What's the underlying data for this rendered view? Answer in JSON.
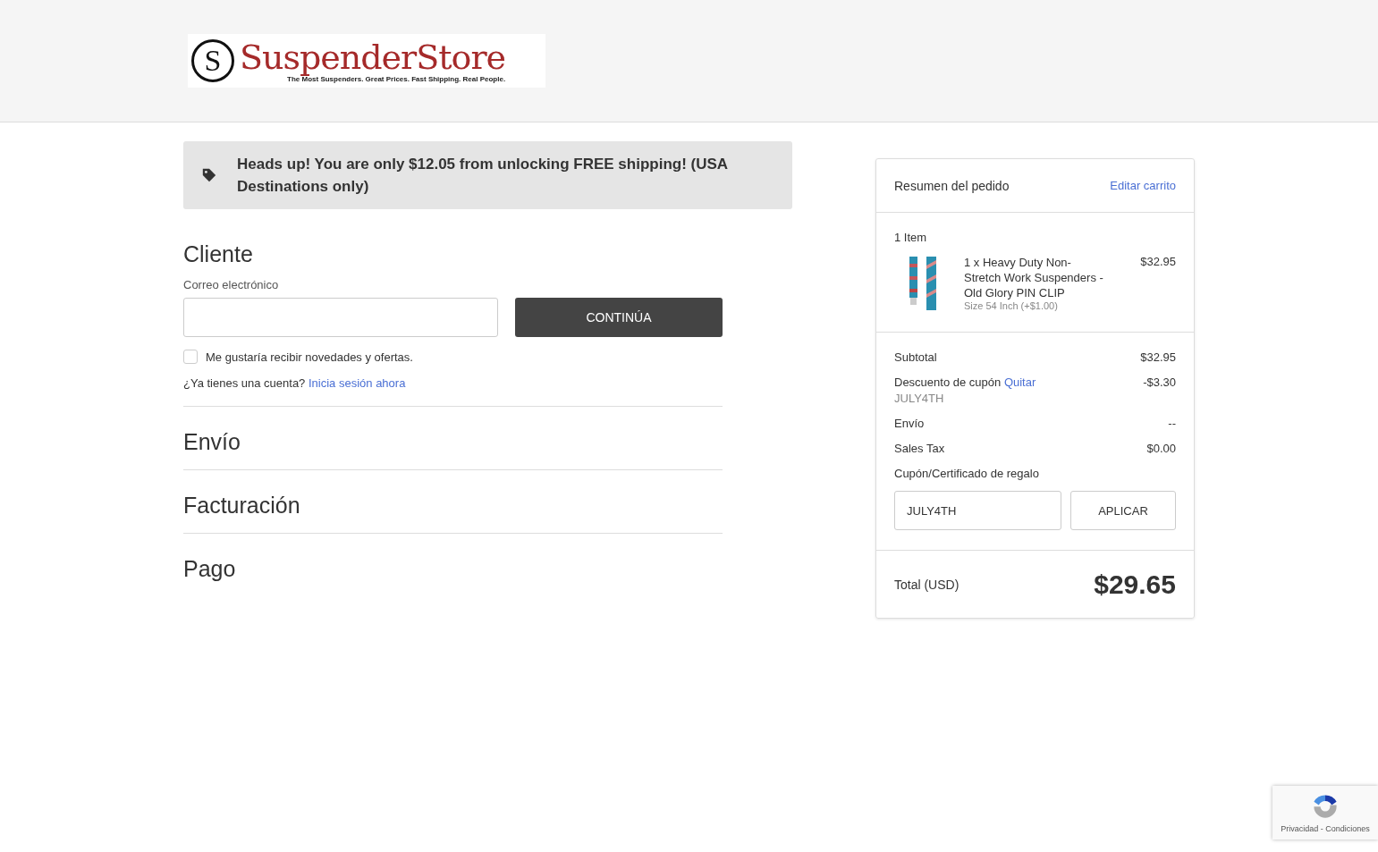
{
  "logo": {
    "mark": "S",
    "name": "SuspenderStore",
    "tagline": "The Most Suspenders. Great Prices. Fast Shipping. Real People."
  },
  "banner": {
    "text": "Heads up! You are only $12.05 from unlocking FREE shipping! (USA Destinations only)"
  },
  "customer": {
    "heading": "Cliente",
    "email_label": "Correo electrónico",
    "continue_button": "CONTINÚA",
    "newsletter": {
      "label": "Me gustaría recibir novedades y ofertas.",
      "checked": false
    },
    "account_prompt": "¿Ya tienes una cuenta?",
    "sign_in_link": "Inicia sesión ahora"
  },
  "sections": [
    {
      "heading": "Envío"
    },
    {
      "heading": "Facturación"
    },
    {
      "heading": "Pago"
    }
  ],
  "summary": {
    "title": "Resumen del pedido",
    "edit_link": "Editar carrito",
    "item_count": "1 Item",
    "items": [
      {
        "kind": "picture",
        "name": "1 x Heavy Duty Non-Stretch Work Suspenders - Old Glory PIN CLIP",
        "option": "Size 54 Inch (+$1.00)",
        "price": "$32.95"
      }
    ],
    "lines": [
      {
        "label": "Subtotal",
        "value": "$32.95"
      },
      {
        "label": "Descuento de cupón",
        "link": "Quitar",
        "code": "JULY4TH",
        "value": "-$3.30"
      },
      {
        "label": "Envío",
        "value": "--"
      },
      {
        "label": "Sales Tax",
        "value": "$0.00"
      }
    ],
    "coupon_label": "Cupón/Certificado de regalo",
    "coupon_value": "JULY4TH",
    "apply_button": "APLICAR",
    "total_label": "Total (USD)",
    "total_value": "$29.65"
  },
  "recaptcha": {
    "text": "Privacidad - Condiciones"
  }
}
